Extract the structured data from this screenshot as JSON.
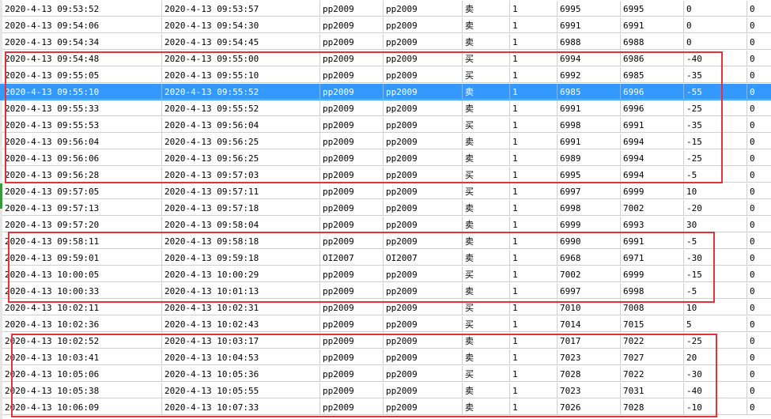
{
  "table": {
    "rows": [
      {
        "open_time": "2020-4-13 09:53:52",
        "close_time": "2020-4-13 09:53:57",
        "contract": "pp2009",
        "contract2": "pp2009",
        "side": "卖",
        "qty": "1",
        "open_price": "6995",
        "close_price": "6995",
        "pnl": "0",
        "fee": "0"
      },
      {
        "open_time": "2020-4-13 09:54:06",
        "close_time": "2020-4-13 09:54:30",
        "contract": "pp2009",
        "contract2": "pp2009",
        "side": "卖",
        "qty": "1",
        "open_price": "6991",
        "close_price": "6991",
        "pnl": "0",
        "fee": "0"
      },
      {
        "open_time": "2020-4-13 09:54:34",
        "close_time": "2020-4-13 09:54:45",
        "contract": "pp2009",
        "contract2": "pp2009",
        "side": "卖",
        "qty": "1",
        "open_price": "6988",
        "close_price": "6988",
        "pnl": "0",
        "fee": "0"
      },
      {
        "open_time": "2020-4-13 09:54:48",
        "close_time": "2020-4-13 09:55:00",
        "contract": "pp2009",
        "contract2": "pp2009",
        "side": "买",
        "qty": "1",
        "open_price": "6994",
        "close_price": "6986",
        "pnl": "-40",
        "fee": "0"
      },
      {
        "open_time": "2020-4-13 09:55:05",
        "close_time": "2020-4-13 09:55:10",
        "contract": "pp2009",
        "contract2": "pp2009",
        "side": "买",
        "qty": "1",
        "open_price": "6992",
        "close_price": "6985",
        "pnl": "-35",
        "fee": "0"
      },
      {
        "open_time": "2020-4-13 09:55:10",
        "close_time": "2020-4-13 09:55:52",
        "contract": "pp2009",
        "contract2": "pp2009",
        "side": "卖",
        "qty": "1",
        "open_price": "6985",
        "close_price": "6996",
        "pnl": "-55",
        "fee": "0"
      },
      {
        "open_time": "2020-4-13 09:55:33",
        "close_time": "2020-4-13 09:55:52",
        "contract": "pp2009",
        "contract2": "pp2009",
        "side": "卖",
        "qty": "1",
        "open_price": "6991",
        "close_price": "6996",
        "pnl": "-25",
        "fee": "0"
      },
      {
        "open_time": "2020-4-13 09:55:53",
        "close_time": "2020-4-13 09:56:04",
        "contract": "pp2009",
        "contract2": "pp2009",
        "side": "买",
        "qty": "1",
        "open_price": "6998",
        "close_price": "6991",
        "pnl": "-35",
        "fee": "0"
      },
      {
        "open_time": "2020-4-13 09:56:04",
        "close_time": "2020-4-13 09:56:25",
        "contract": "pp2009",
        "contract2": "pp2009",
        "side": "卖",
        "qty": "1",
        "open_price": "6991",
        "close_price": "6994",
        "pnl": "-15",
        "fee": "0"
      },
      {
        "open_time": "2020-4-13 09:56:06",
        "close_time": "2020-4-13 09:56:25",
        "contract": "pp2009",
        "contract2": "pp2009",
        "side": "卖",
        "qty": "1",
        "open_price": "6989",
        "close_price": "6994",
        "pnl": "-25",
        "fee": "0"
      },
      {
        "open_time": "2020-4-13 09:56:28",
        "close_time": "2020-4-13 09:57:03",
        "contract": "pp2009",
        "contract2": "pp2009",
        "side": "买",
        "qty": "1",
        "open_price": "6995",
        "close_price": "6994",
        "pnl": "-5",
        "fee": "0"
      },
      {
        "open_time": "2020-4-13 09:57:05",
        "close_time": "2020-4-13 09:57:11",
        "contract": "pp2009",
        "contract2": "pp2009",
        "side": "买",
        "qty": "1",
        "open_price": "6997",
        "close_price": "6999",
        "pnl": "10",
        "fee": "0"
      },
      {
        "open_time": "2020-4-13 09:57:13",
        "close_time": "2020-4-13 09:57:18",
        "contract": "pp2009",
        "contract2": "pp2009",
        "side": "卖",
        "qty": "1",
        "open_price": "6998",
        "close_price": "7002",
        "pnl": "-20",
        "fee": "0"
      },
      {
        "open_time": "2020-4-13 09:57:20",
        "close_time": "2020-4-13 09:58:04",
        "contract": "pp2009",
        "contract2": "pp2009",
        "side": "卖",
        "qty": "1",
        "open_price": "6999",
        "close_price": "6993",
        "pnl": "30",
        "fee": "0"
      },
      {
        "open_time": "2020-4-13 09:58:11",
        "close_time": "2020-4-13 09:58:18",
        "contract": "pp2009",
        "contract2": "pp2009",
        "side": "卖",
        "qty": "1",
        "open_price": "6990",
        "close_price": "6991",
        "pnl": "-5",
        "fee": "0"
      },
      {
        "open_time": "2020-4-13 09:59:01",
        "close_time": "2020-4-13 09:59:18",
        "contract": "OI2007",
        "contract2": "OI2007",
        "side": "卖",
        "qty": "1",
        "open_price": "6968",
        "close_price": "6971",
        "pnl": "-30",
        "fee": "0"
      },
      {
        "open_time": "2020-4-13 10:00:05",
        "close_time": "2020-4-13 10:00:29",
        "contract": "pp2009",
        "contract2": "pp2009",
        "side": "买",
        "qty": "1",
        "open_price": "7002",
        "close_price": "6999",
        "pnl": "-15",
        "fee": "0"
      },
      {
        "open_time": "2020-4-13 10:00:33",
        "close_time": "2020-4-13 10:01:13",
        "contract": "pp2009",
        "contract2": "pp2009",
        "side": "卖",
        "qty": "1",
        "open_price": "6997",
        "close_price": "6998",
        "pnl": "-5",
        "fee": "0"
      },
      {
        "open_time": "2020-4-13 10:02:11",
        "close_time": "2020-4-13 10:02:31",
        "contract": "pp2009",
        "contract2": "pp2009",
        "side": "买",
        "qty": "1",
        "open_price": "7010",
        "close_price": "7008",
        "pnl": "10",
        "fee": "0"
      },
      {
        "open_time": "2020-4-13 10:02:36",
        "close_time": "2020-4-13 10:02:43",
        "contract": "pp2009",
        "contract2": "pp2009",
        "side": "买",
        "qty": "1",
        "open_price": "7014",
        "close_price": "7015",
        "pnl": "5",
        "fee": "0"
      },
      {
        "open_time": "2020-4-13 10:02:52",
        "close_time": "2020-4-13 10:03:17",
        "contract": "pp2009",
        "contract2": "pp2009",
        "side": "卖",
        "qty": "1",
        "open_price": "7017",
        "close_price": "7022",
        "pnl": "-25",
        "fee": "0"
      },
      {
        "open_time": "2020-4-13 10:03:41",
        "close_time": "2020-4-13 10:04:53",
        "contract": "pp2009",
        "contract2": "pp2009",
        "side": "卖",
        "qty": "1",
        "open_price": "7023",
        "close_price": "7027",
        "pnl": "20",
        "fee": "0"
      },
      {
        "open_time": "2020-4-13 10:05:06",
        "close_time": "2020-4-13 10:05:36",
        "contract": "pp2009",
        "contract2": "pp2009",
        "side": "买",
        "qty": "1",
        "open_price": "7028",
        "close_price": "7022",
        "pnl": "-30",
        "fee": "0"
      },
      {
        "open_time": "2020-4-13 10:05:38",
        "close_time": "2020-4-13 10:05:55",
        "contract": "pp2009",
        "contract2": "pp2009",
        "side": "卖",
        "qty": "1",
        "open_price": "7023",
        "close_price": "7031",
        "pnl": "-40",
        "fee": "0"
      },
      {
        "open_time": "2020-4-13 10:06:09",
        "close_time": "2020-4-13 10:07:33",
        "contract": "pp2009",
        "contract2": "pp2009",
        "side": "卖",
        "qty": "1",
        "open_price": "7026",
        "close_price": "7028",
        "pnl": "-10",
        "fee": "0"
      }
    ],
    "selected_row_index": 5
  },
  "highlight_color": "#e5323a",
  "selection_color": "#3399ff"
}
